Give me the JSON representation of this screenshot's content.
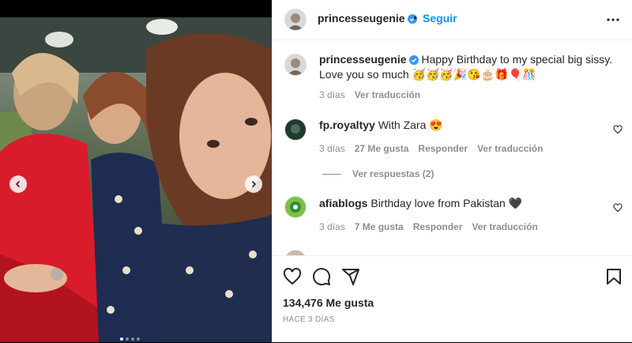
{
  "post": {
    "username": "princesseugenie",
    "follow_label": "Seguir",
    "separator": "•",
    "caption_line1": "Happy Birthday to my special big sissy.",
    "caption_line2": "Love you so much 🥳🥳🥳🎉😘🎂🎁🎈🎊",
    "caption_time": "3 días",
    "caption_translate": "Ver traducción",
    "likes": "134,476 Me gusta",
    "posted_ago": "HACE 3 DÍAS"
  },
  "comments": [
    {
      "username": "fp.royaltyy",
      "text": "With Zara 😍",
      "time": "3 días",
      "likes": "27 Me gusta",
      "reply": "Responder",
      "translate": "Ver traducción",
      "view_replies": "Ver respuestas (2)"
    },
    {
      "username": "afiablogs",
      "text": "Birthday love from Pakistan 🖤",
      "time": "3 días",
      "likes": "7 Me gusta",
      "reply": "Responder",
      "translate": "Ver traducción"
    }
  ],
  "carousel": {
    "slide_count": 4,
    "active_index": 0
  },
  "colors": {
    "link": "#0095f6",
    "verified": "#3897f0",
    "muted": "#8e8e8e",
    "text": "#262626"
  },
  "icons": [
    "verified-icon",
    "more-options-icon",
    "heart-icon",
    "comment-icon",
    "share-icon",
    "save-icon",
    "chevron-left-icon",
    "chevron-right-icon"
  ]
}
